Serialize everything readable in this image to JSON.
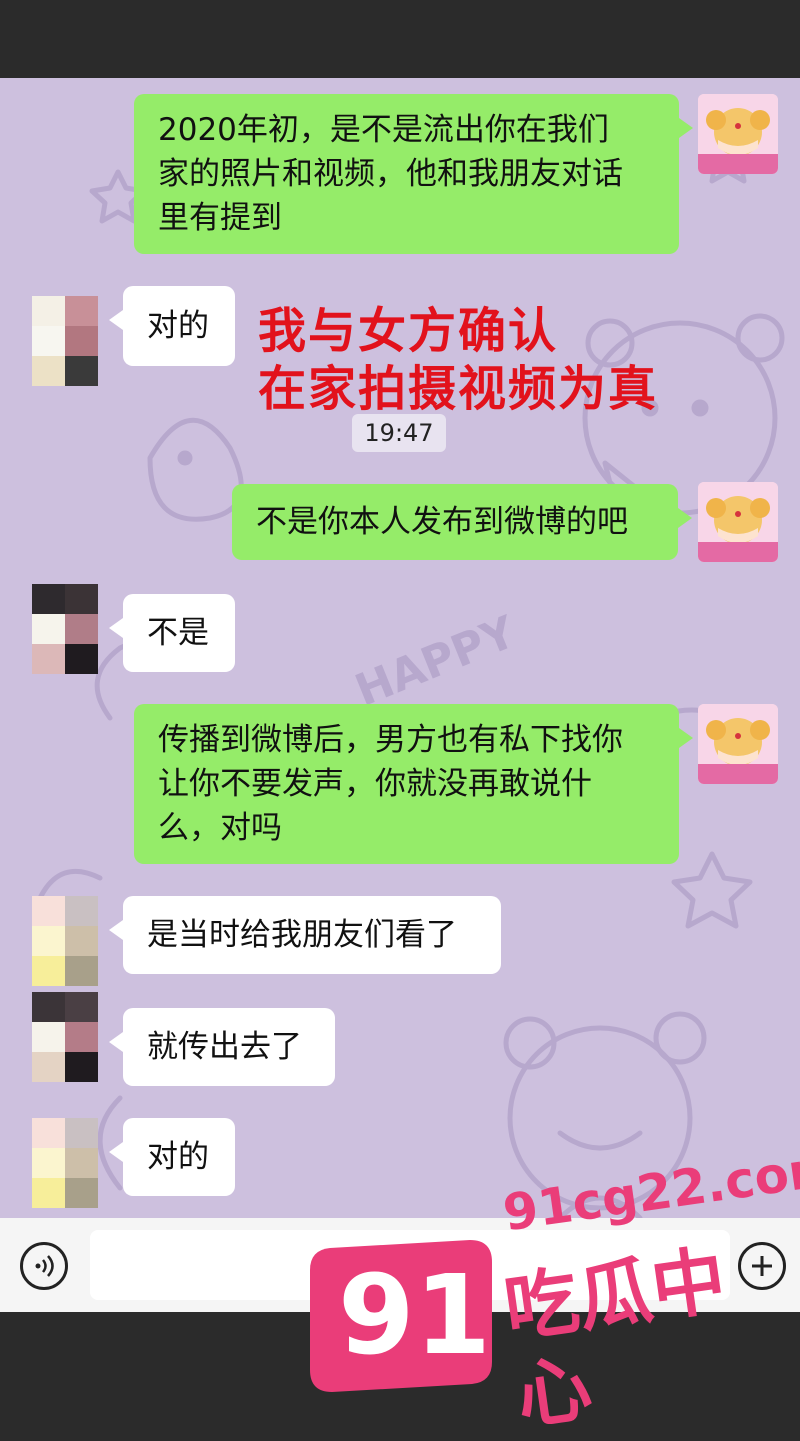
{
  "messages": [
    {
      "side": "right",
      "text": "2020年初，是不是流出你在我们\n家的照片和视频，他和我朋友对话\n里有提到"
    },
    {
      "side": "left",
      "text": "对的"
    },
    {
      "side": "right",
      "text": "不是你本人发布到微博的吧"
    },
    {
      "side": "left",
      "text": "不是"
    },
    {
      "side": "right",
      "text": "传播到微博后，男方也有私下找你\n让你不要发声，你就没再敢说什\n么，对吗"
    },
    {
      "side": "left",
      "text": "是当时给我朋友们看了"
    },
    {
      "side": "left",
      "text": "就传出去了"
    },
    {
      "side": "left",
      "text": "对的"
    }
  ],
  "timestamp": "19:47",
  "annotation": {
    "line1": "我与女方确认",
    "line2": "在家拍摄视频为真",
    "color": "#e2121c"
  },
  "wallpaper": {
    "text": "HAPPY"
  },
  "watermark": {
    "number": "91",
    "domain": "91cg22.com",
    "name": "吃瓜中心",
    "color": "#ea3d79"
  },
  "icons": {
    "voice": "voice-icon",
    "more": "plus-icon"
  },
  "colors": {
    "bubble_green": "#95ec69",
    "bubble_white": "#ffffff",
    "chat_bg": "#cdc0de"
  }
}
